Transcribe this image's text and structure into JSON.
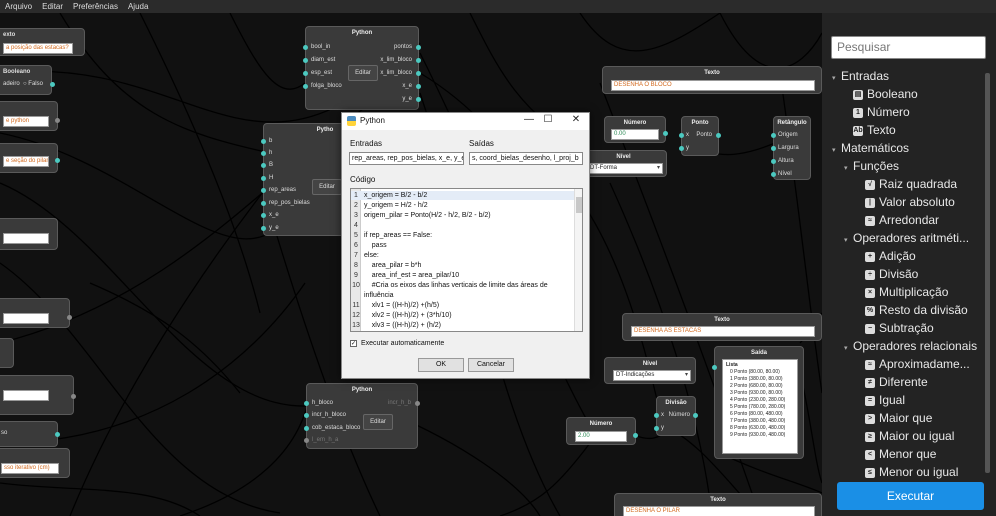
{
  "menu": [
    "Arquivo",
    "Editar",
    "Preferências",
    "Ajuda"
  ],
  "nodes": {
    "python_top": {
      "title": "Python",
      "inputs": [
        "bool_in",
        "diam_est",
        "esp_est",
        "folga_bloco"
      ],
      "outputs": [
        "pontos",
        "x_lim_bloco",
        "x_lim_bloco",
        "x_e",
        "y_e"
      ],
      "edit": "Editar"
    },
    "python_mid": {
      "title": "Pytho",
      "inputs": [
        "b",
        "h",
        "B",
        "H",
        "rep_areas",
        "rep_pos_bielas",
        "x_e",
        "y_e"
      ],
      "edit": "Editar"
    },
    "python_bottom": {
      "title": "Python",
      "inputs": [
        "h_bloco",
        "incr_h_bloco",
        "cob_estaca_bloco",
        "l_em_h_a"
      ],
      "outputs": [
        "incr_h_b"
      ],
      "edit": "Editar"
    },
    "texto_top": {
      "title": "Texto",
      "value": "DESENHA O BLOCO"
    },
    "numero_top": {
      "title": "Número",
      "value": "0.00"
    },
    "ponto_top": {
      "title": "Ponto",
      "ports": [
        "x",
        "y",
        "Ponto"
      ]
    },
    "retangulo": {
      "title": "Retângulo",
      "ports": [
        "Origem",
        "Largura",
        "Altura",
        "Nível"
      ]
    },
    "nivel_top": {
      "title": "Nível",
      "value": "DT-Forma"
    },
    "texto_mid": {
      "title": "Texto",
      "value": "DESENHA AS ESTACAS"
    },
    "nivel_mid": {
      "title": "Nível",
      "value": "DT-Indicações"
    },
    "divisao": {
      "title": "Divisão",
      "ports": [
        "x",
        "y",
        "Número"
      ]
    },
    "numero_bot": {
      "title": "Número",
      "value": "2.00"
    },
    "saida": {
      "title": "Saída",
      "list_title": "Lista",
      "items": [
        "0 Ponto (80.00, 80.00)",
        "1 Ponto (380.00, 80.00)",
        "2 Ponto (680.00, 80.00)",
        "3 Ponto (930.00, 80.00)",
        "4 Ponto (230.00, 280.00)",
        "5 Ponto (780.00, 280.00)",
        "6 Ponto (80.00, 480.00)",
        "7 Ponto (380.00, 480.00)",
        "8 Ponto (630.00, 480.00)",
        "9 Ponto (930.00, 480.00)"
      ]
    },
    "texto_bot": {
      "title": "Texto",
      "value": "DESENHA O PILAR"
    },
    "left_texto1": {
      "title": "exto",
      "value": "a posição das estacas?"
    },
    "left_booleano": {
      "title": "Booleano",
      "options": [
        "adeiro",
        "Falso"
      ]
    },
    "left_python_text": {
      "value": "e python"
    },
    "left_pilar_text": {
      "value": "e seção do pilar?"
    },
    "left_so": {
      "value": "so"
    },
    "left_iterativo": {
      "value": "sso iterativo (cm)"
    }
  },
  "dialog": {
    "title": "Python",
    "entradas_label": "Entradas",
    "entradas_value": "rep_areas, rep_pos_bielas, x_e, y_e",
    "saidas_label": "Saídas",
    "saidas_value": "s, coord_bielas_desenho, l_proj_b",
    "codigo_label": "Código",
    "code_lines": [
      {
        "n": "1",
        "t": "x_origem = B/2 - b/2"
      },
      {
        "n": "2",
        "t": "y_origem = H/2 - h/2"
      },
      {
        "n": "3",
        "t": "origem_pilar = Ponto(H/2 - h/2, B/2 - b/2)"
      },
      {
        "n": "4",
        "t": ""
      },
      {
        "n": "5",
        "t": "if rep_areas == False:"
      },
      {
        "n": "6",
        "t": "    pass"
      },
      {
        "n": "7",
        "t": "else:"
      },
      {
        "n": "8",
        "t": "    area_pilar = b*h"
      },
      {
        "n": "9",
        "t": "    area_inf_est = area_pilar/10"
      },
      {
        "n": "10",
        "t": "    #Cria os eixos das linhas verticais de limite das áreas de"
      },
      {
        "n": "",
        "t": "influência"
      },
      {
        "n": "11",
        "t": "    xlv1 = ((H-h)/2) +(h/5)"
      },
      {
        "n": "12",
        "t": "    xlv2 = ((H-h)/2) + (3*h/10)"
      },
      {
        "n": "13",
        "t": "    xlv3 = ((H-h)/2) + (h/2)"
      }
    ],
    "auto_label": "Executar automaticamente",
    "ok": "OK",
    "cancel": "Cancelar"
  },
  "sidebar": {
    "search_placeholder": "Pesquisar",
    "tree": [
      {
        "label": "Entradas",
        "level": 0,
        "arrow": "▾"
      },
      {
        "label": "Booleano",
        "level": 1,
        "icon": "▤"
      },
      {
        "label": "Número",
        "level": 1,
        "icon": "1"
      },
      {
        "label": "Texto",
        "level": 1,
        "icon": "Ab"
      },
      {
        "label": "Matemáticos",
        "level": 0,
        "arrow": "▾"
      },
      {
        "label": "Funções",
        "level": 1,
        "arrow": "▾"
      },
      {
        "label": "Raiz quadrada",
        "level": 2,
        "icon": "√"
      },
      {
        "label": "Valor absoluto",
        "level": 2,
        "icon": "|"
      },
      {
        "label": "Arredondar",
        "level": 2,
        "icon": "≈"
      },
      {
        "label": "Operadores aritméti...",
        "level": 1,
        "arrow": "▾"
      },
      {
        "label": "Adição",
        "level": 2,
        "icon": "+"
      },
      {
        "label": "Divisão",
        "level": 2,
        "icon": "÷"
      },
      {
        "label": "Multiplicação",
        "level": 2,
        "icon": "×"
      },
      {
        "label": "Resto da divisão",
        "level": 2,
        "icon": "%"
      },
      {
        "label": "Subtração",
        "level": 2,
        "icon": "−"
      },
      {
        "label": "Operadores relacionais",
        "level": 1,
        "arrow": "▾"
      },
      {
        "label": "Aproximadame...",
        "level": 2,
        "icon": "≈"
      },
      {
        "label": "Diferente",
        "level": 2,
        "icon": "≠"
      },
      {
        "label": "Igual",
        "level": 2,
        "icon": "="
      },
      {
        "label": "Maior que",
        "level": 2,
        "icon": ">"
      },
      {
        "label": "Maior ou igual",
        "level": 2,
        "icon": "≥"
      },
      {
        "label": "Menor que",
        "level": 2,
        "icon": "<"
      },
      {
        "label": "Menor ou igual",
        "level": 2,
        "icon": "≤"
      }
    ],
    "run_label": "Executar"
  },
  "colors": {
    "accent": "#1a8fe6",
    "port": "#4cc9c0",
    "canvas": "#111111",
    "node": "#3a3a3a"
  }
}
